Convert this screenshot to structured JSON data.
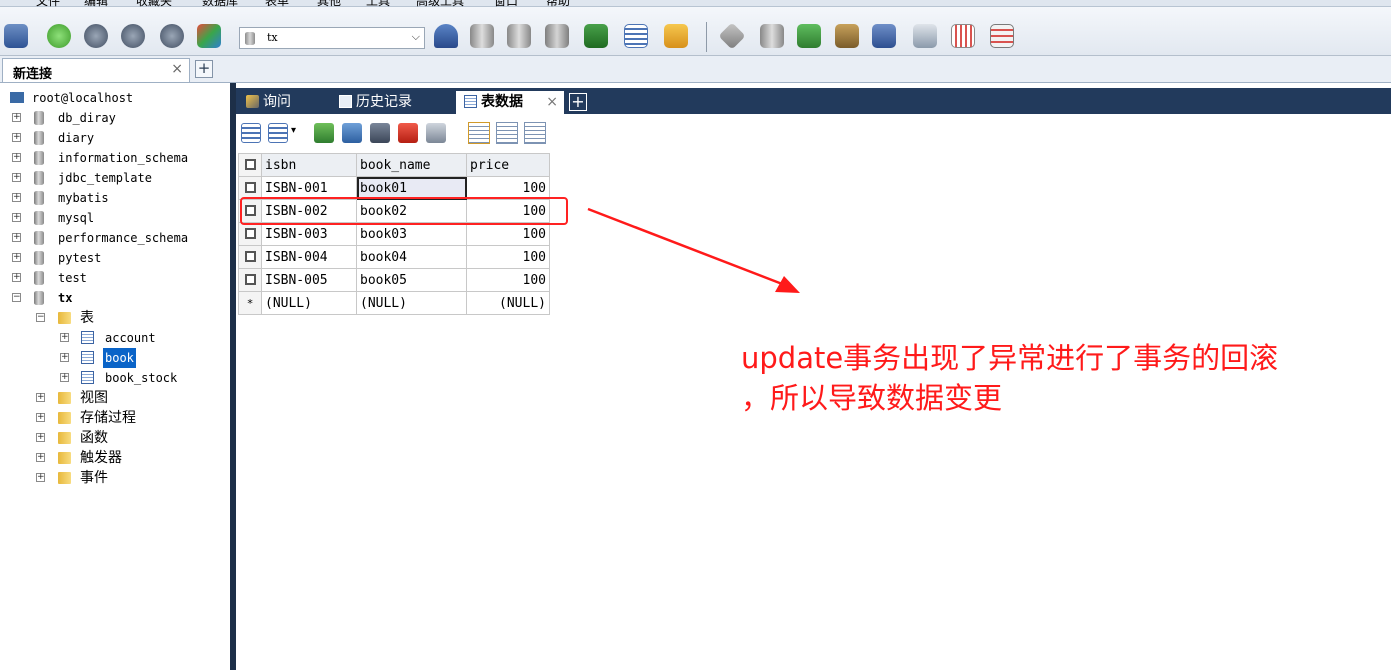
{
  "menu": {
    "items": [
      "文件",
      "编辑",
      "收藏夹",
      "数据库",
      "表单",
      "其他",
      "工具",
      "高级工具",
      "窗口",
      "帮助"
    ]
  },
  "toolbar": {
    "database_select": "tx"
  },
  "connection_tab": {
    "label": "新连接",
    "close": "×",
    "add": "+"
  },
  "tree": {
    "root": "root@localhost",
    "databases": [
      "db_diray",
      "diary",
      "information_schema",
      "jdbc_template",
      "mybatis",
      "mysql",
      "performance_schema",
      "pytest",
      "test"
    ],
    "open_db": "tx",
    "tables_folder": "表",
    "tables": [
      "account",
      "book",
      "book_stock"
    ],
    "selected_table": "book",
    "other_folders": [
      "视图",
      "存储过程",
      "函数",
      "触发器",
      "事件"
    ]
  },
  "object_tabs": [
    {
      "label": "询问"
    },
    {
      "label": "历史记录"
    },
    {
      "label": "表数据"
    }
  ],
  "object_tab_close": "×",
  "object_tab_add": "+",
  "table": {
    "columns": [
      "isbn",
      "book_name",
      "price"
    ],
    "rows": [
      [
        "ISBN-001",
        "book01",
        "100"
      ],
      [
        "ISBN-002",
        "book02",
        "100"
      ],
      [
        "ISBN-003",
        "book03",
        "100"
      ],
      [
        "ISBN-004",
        "book04",
        "100"
      ],
      [
        "ISBN-005",
        "book05",
        "100"
      ]
    ],
    "new_row": [
      "*",
      "(NULL)",
      "(NULL)",
      "(NULL)"
    ]
  },
  "annotation": {
    "line1": "update事务出现了异常进行了事务的回滚",
    "line2": "，所以导致数据变更",
    "color": "#ff1a1a"
  }
}
